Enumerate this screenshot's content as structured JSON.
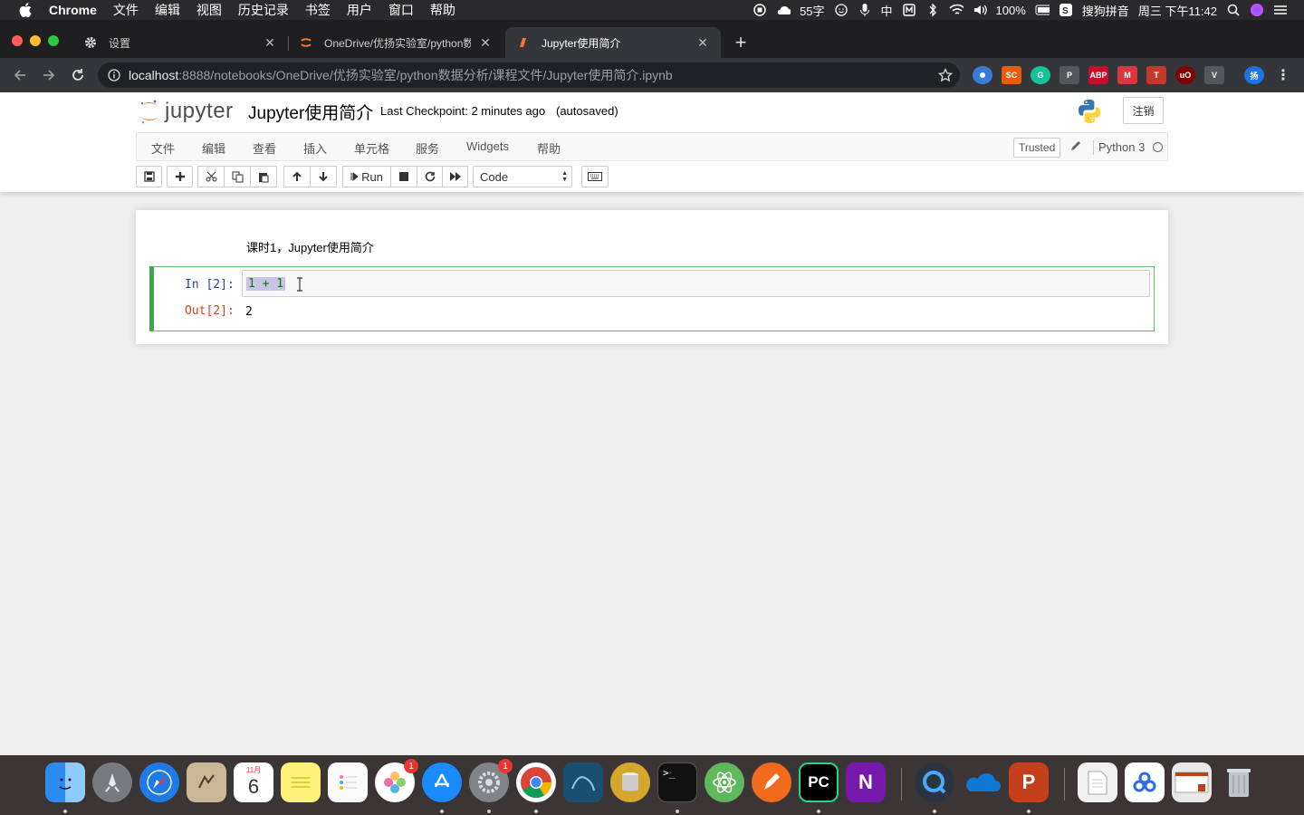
{
  "macos": {
    "app_name": "Chrome",
    "menu": [
      "文件",
      "编辑",
      "视图",
      "历史记录",
      "书签",
      "用户",
      "窗口",
      "帮助"
    ],
    "status": {
      "temp": "55字",
      "input_char": "中",
      "battery": "100%",
      "ime": "搜狗拼音",
      "datetime": "周三 下午11:42"
    }
  },
  "chrome": {
    "tabs": [
      {
        "title": "设置",
        "icon": "gear-icon"
      },
      {
        "title": "OneDrive/优扬实验室/python数",
        "icon": "jupyter-icon"
      },
      {
        "title": "Jupyter使用简介",
        "icon": "jupyter-icon",
        "active": true
      }
    ],
    "url_host": "localhost",
    "url_rest": ":8888/notebooks/OneDrive/优扬实验室/python数据分析/课程文件/Jupyter使用简介.ipynb",
    "extensions": [
      "SC",
      "G",
      "P",
      "ABP",
      "M",
      "T",
      "uO",
      "V",
      "扬"
    ]
  },
  "jupyter": {
    "logo_text": "jupyter",
    "title": "Jupyter使用简介",
    "checkpoint": "Last Checkpoint: 2 minutes ago",
    "autosaved": "(autosaved)",
    "logout": "注销",
    "menu": [
      "文件",
      "编辑",
      "查看",
      "插入",
      "单元格",
      "服务",
      "Widgets",
      "帮助"
    ],
    "trusted": "Trusted",
    "kernel": "Python 3",
    "run_label": "Run",
    "cell_type": "Code",
    "markdown_text": "课时1，Jupyter使用简介",
    "cell": {
      "in_prompt": "In [2]:",
      "code": "1 + 1",
      "out_prompt": "Out[2]:",
      "output": "2"
    }
  },
  "dock": {
    "calendar_month": "11月",
    "calendar_day": "6",
    "photos_badge": "1",
    "prefs_badge": "1",
    "pycharm": "PC",
    "onenote": "N"
  }
}
